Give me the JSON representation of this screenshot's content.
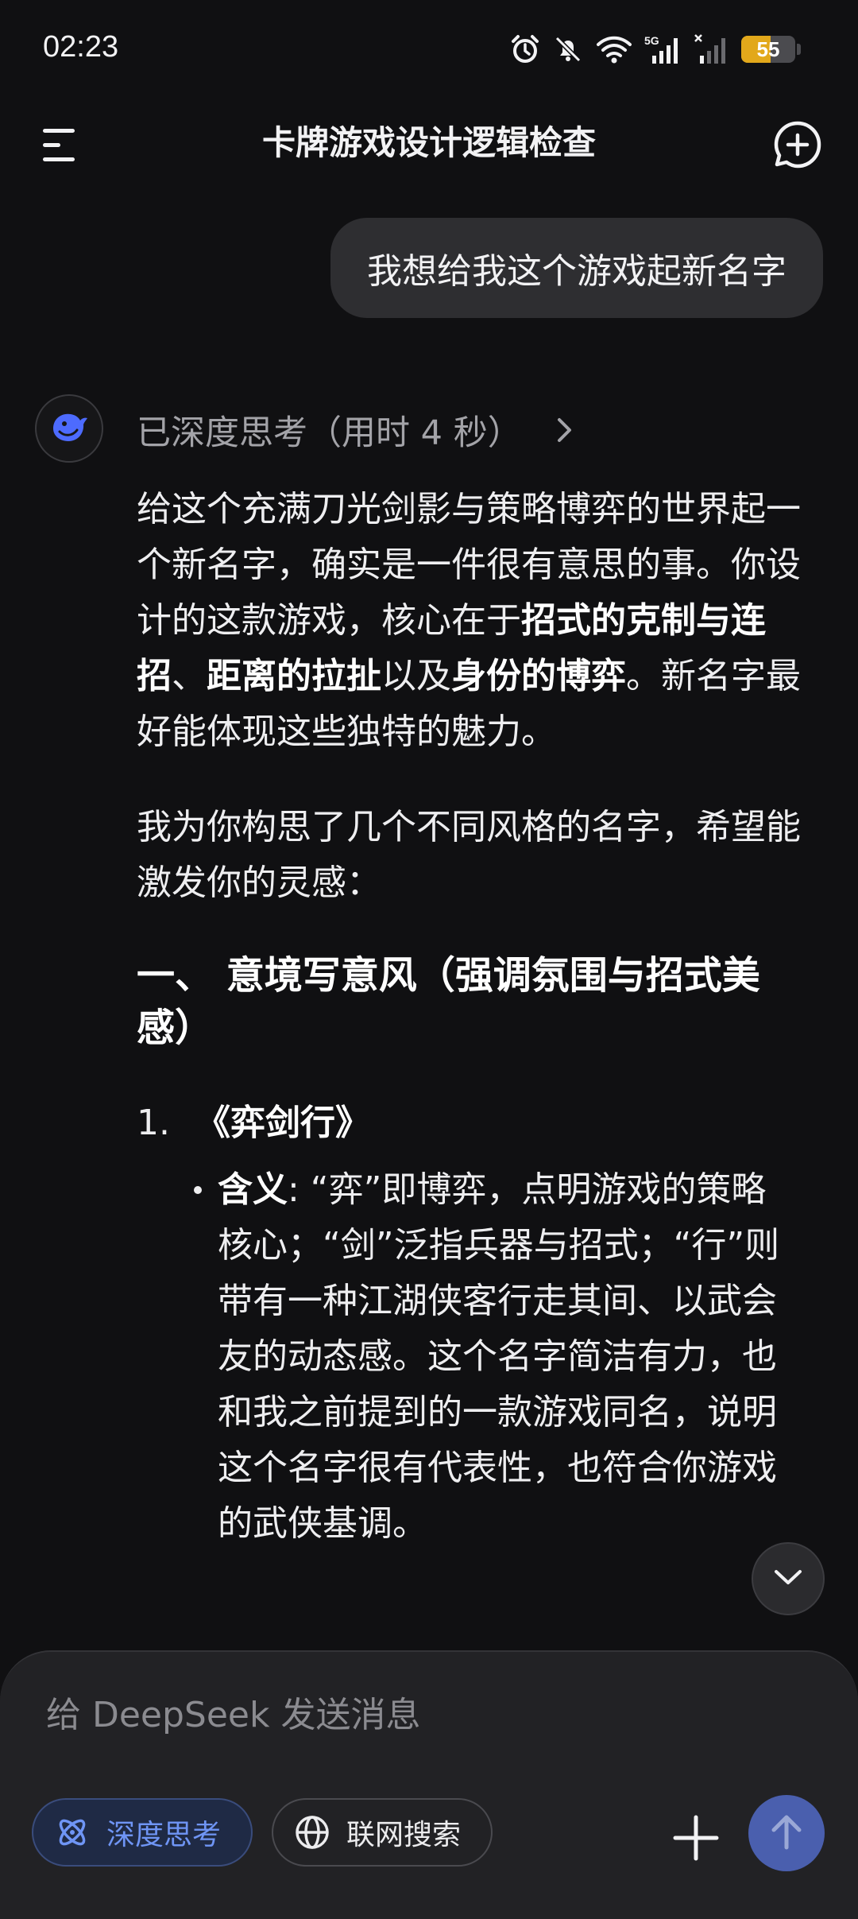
{
  "status_bar": {
    "time": "02:23",
    "battery_level": "55",
    "battery_fraction": 0.55,
    "icons": [
      "alarm-icon",
      "mute-icon",
      "wifi-icon",
      "signal-5g-icon",
      "signal-icon",
      "battery-icon"
    ]
  },
  "header": {
    "title": "卡牌游戏设计逻辑检查",
    "menu_icon": "menu-icon",
    "new_chat_icon": "new-chat-icon"
  },
  "chat": {
    "user_message": "我想给我这个游戏起新名字",
    "think_status": "已深度思考（用时 4 秒）",
    "answer": {
      "p1_a": "给这个充满刀光剑影与策略博弈的世界起一个新名字，确实是一件很有意思的事。你设计的这款游戏，核心在于",
      "p1_b1": "招式的克制与连招",
      "p1_sep1": "、",
      "p1_b2": "距离的拉扯",
      "p1_mid": "以及",
      "p1_b3": "身份的博弈",
      "p1_end": "。新名字最好能体现这些独特的魅力。",
      "p2": "我为你构思了几个不同风格的名字，希望能激发你的灵感：",
      "h_section": "一、 意境写意风（强调氛围与招式美感）",
      "item1_num": "1.",
      "item1_title": "《弈剑行》",
      "item1_label": "含义",
      "item1_text": ": “弈”即博弈，点明游戏的策略核心；“剑”泛指兵器与招式；“行”则带有一种江湖侠客行走其间、以武会友的动态感。这个名字简洁有力，也和我之前提到的一款游戏同名，说明这个名字很有代表性，也符合你游戏的武侠基调。"
    }
  },
  "composer": {
    "placeholder": "给 DeepSeek 发送消息",
    "deep_think_label": "深度思考",
    "web_search_label": "联网搜索"
  },
  "colors": {
    "background": "#101012",
    "bubble": "#2e2e31",
    "accent": "#4d6bfe",
    "deep_think_chip_text": "#6f95f5",
    "send_button": "#4a5fae",
    "battery": "#e2a81b"
  }
}
